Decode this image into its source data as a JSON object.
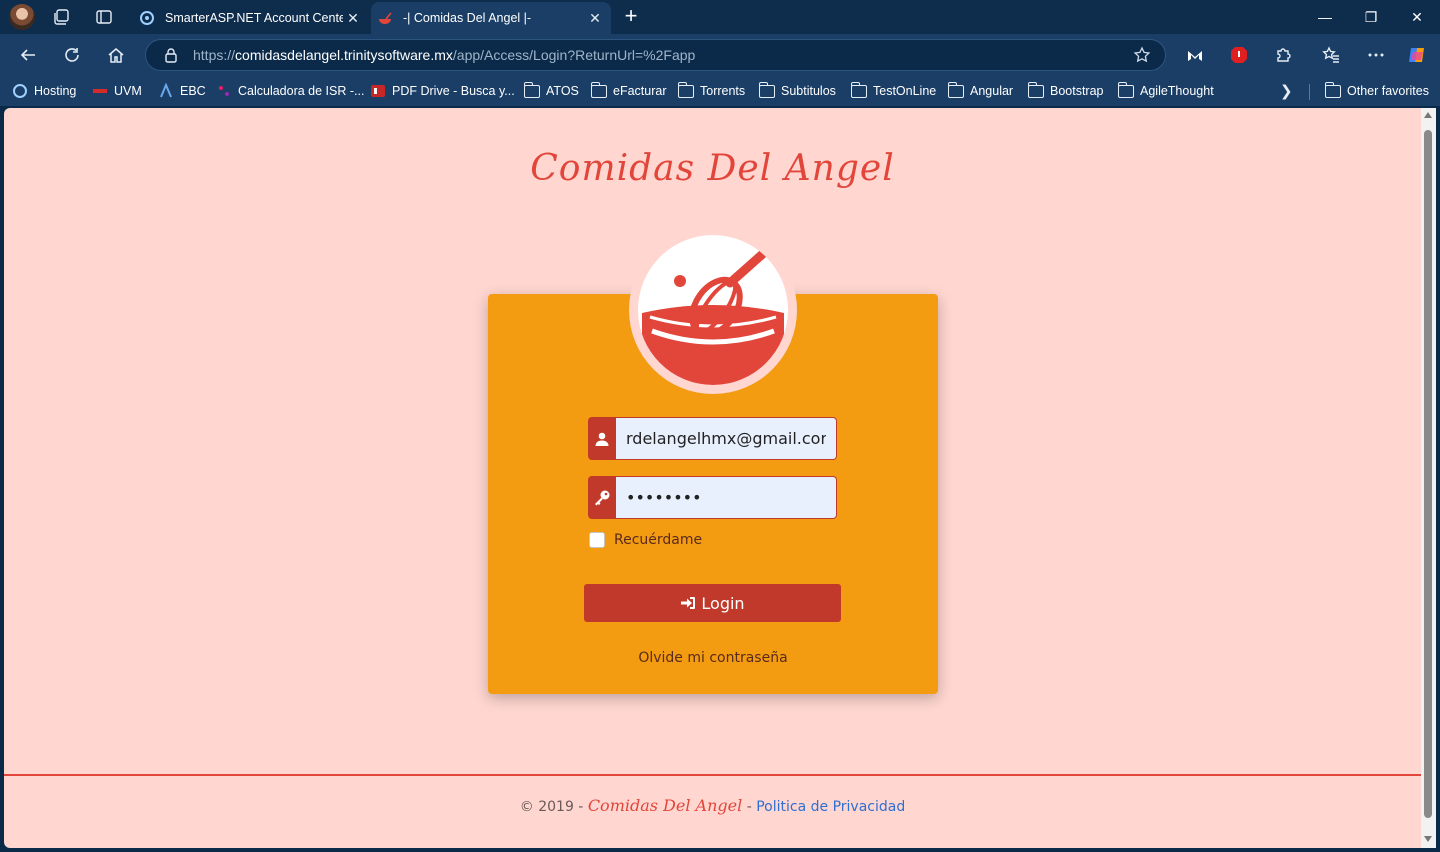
{
  "browser": {
    "tabs": [
      {
        "title": "SmarterASP.NET Account Center",
        "active": false
      },
      {
        "title": "-| Comidas Del Angel |-",
        "active": true
      }
    ],
    "address": {
      "url_prefix": "https://",
      "url_domain": "comidasdelangel.trinitysoftware.mx",
      "url_path": "/app/Access/Login?ReturnUrl=%2Fapp"
    },
    "bookmarks": [
      {
        "label": "Hosting",
        "icon": "hosting-icon"
      },
      {
        "label": "UVM",
        "icon": "uvm-icon"
      },
      {
        "label": "EBC",
        "icon": "ebc-icon"
      },
      {
        "label": "Calculadora de ISR -...",
        "icon": "calc-icon"
      },
      {
        "label": "PDF Drive - Busca y...",
        "icon": "pdf-icon"
      },
      {
        "label": "ATOS",
        "icon": "folder-icon"
      },
      {
        "label": "eFacturar",
        "icon": "folder-icon"
      },
      {
        "label": "Torrents",
        "icon": "folder-icon"
      },
      {
        "label": "Subtitulos",
        "icon": "folder-icon"
      },
      {
        "label": "TestOnLine",
        "icon": "folder-icon"
      },
      {
        "label": "Angular",
        "icon": "folder-icon"
      },
      {
        "label": "Bootstrap",
        "icon": "folder-icon"
      },
      {
        "label": "AgileThought",
        "icon": "folder-icon"
      }
    ],
    "other_favorites": "Other favorites"
  },
  "page": {
    "brand_title": "Comidas Del Angel",
    "login": {
      "username_value": "rdelangelhmx@gmail.com",
      "password_value": "••••••••",
      "remember_label": "Recuérdame",
      "remember_checked": false,
      "login_label": "Login",
      "forgot_label": "Olvide mi contraseña"
    },
    "footer": {
      "copyright": "© 2019 -",
      "brand": "Comidas Del Angel",
      "separator": "-",
      "privacy_link": "Politica de Privacidad"
    }
  },
  "colors": {
    "page_bg": "#ffd6d0",
    "card_bg": "#f39c12",
    "accent_red": "#c0392b",
    "brand_red": "#e2463b",
    "link_blue": "#2f6fd1"
  }
}
